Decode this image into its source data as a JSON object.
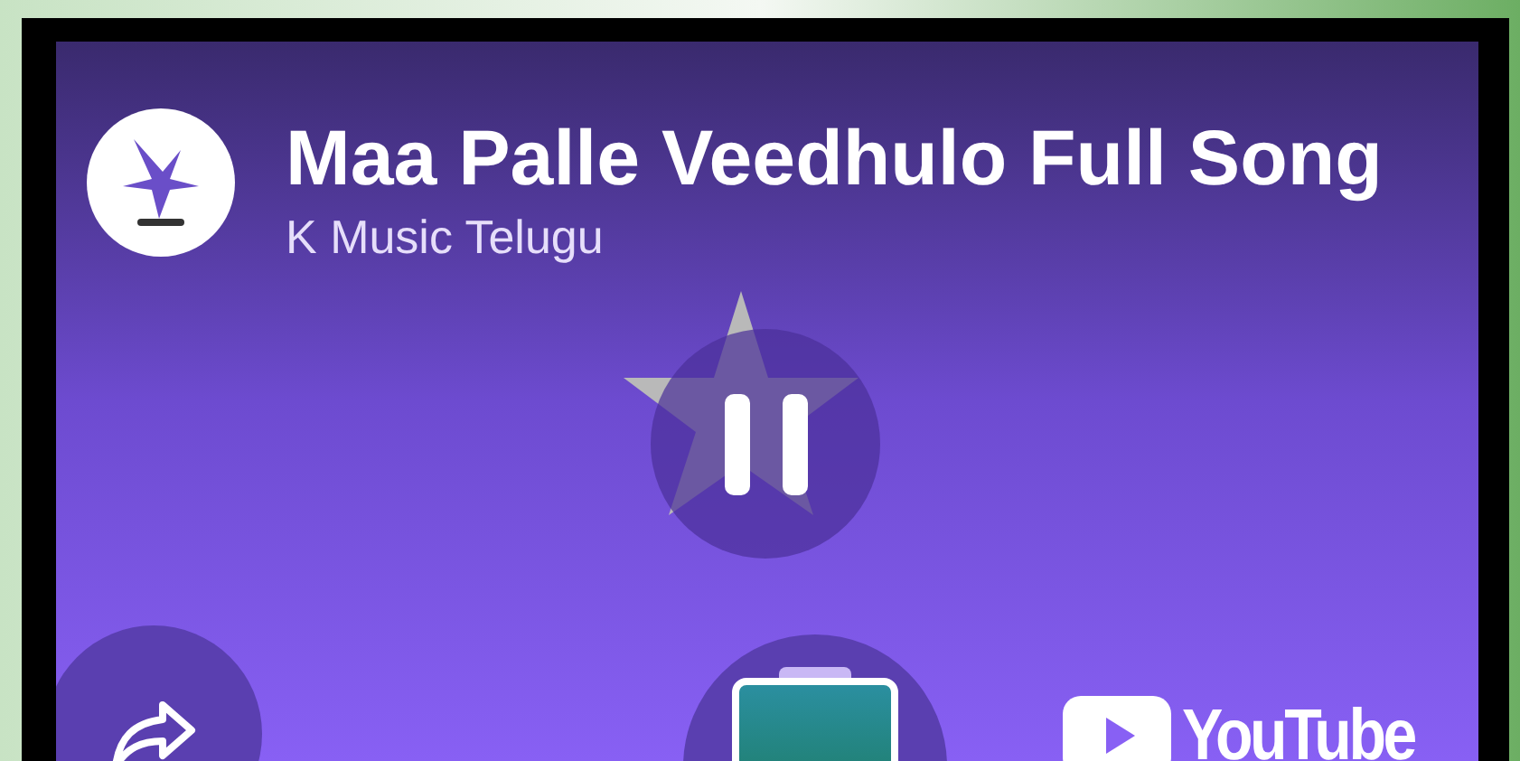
{
  "video": {
    "title": "Maa Palle Veedhulo Full Song",
    "channel": "K Music Telugu",
    "playing": true
  },
  "branding": {
    "wordmark": "YouTube"
  }
}
